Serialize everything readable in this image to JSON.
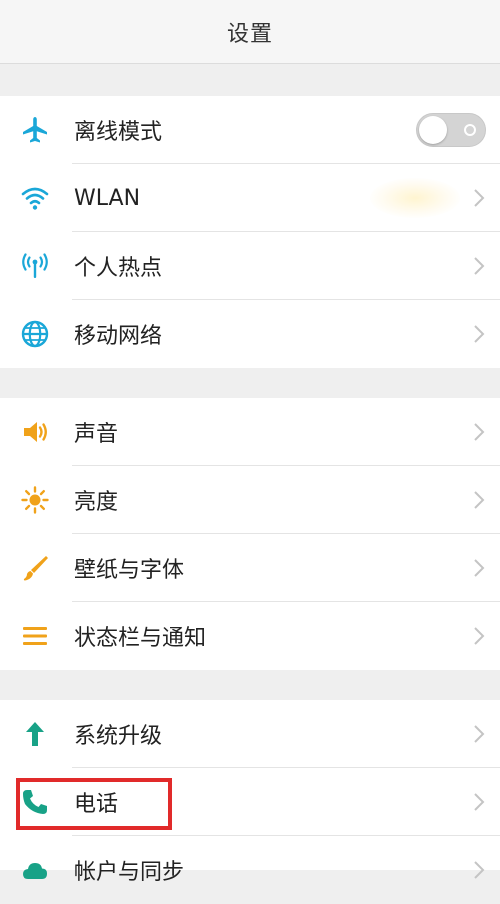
{
  "header": {
    "title": "设置"
  },
  "colors": {
    "accent": "#1aa7d8",
    "green": "#18a287",
    "orange": "#f0a21a",
    "highlight": "#e12a2a"
  },
  "groups": [
    {
      "items": [
        {
          "label": "离线模式",
          "icon": "airplane-icon",
          "control": "toggle",
          "toggle_on": false
        },
        {
          "label": "WLAN",
          "icon": "wifi-icon",
          "control": "chevron"
        },
        {
          "label": "个人热点",
          "icon": "hotspot-icon",
          "control": "chevron"
        },
        {
          "label": "移动网络",
          "icon": "globe-icon",
          "control": "chevron"
        }
      ]
    },
    {
      "items": [
        {
          "label": "声音",
          "icon": "speaker-icon",
          "control": "chevron"
        },
        {
          "label": "亮度",
          "icon": "sun-icon",
          "control": "chevron"
        },
        {
          "label": "壁纸与字体",
          "icon": "brush-icon",
          "control": "chevron"
        },
        {
          "label": "状态栏与通知",
          "icon": "list-icon",
          "control": "chevron"
        }
      ]
    },
    {
      "items": [
        {
          "label": "系统升级",
          "icon": "arrow-up-icon",
          "control": "chevron"
        },
        {
          "label": "电话",
          "icon": "phone-icon",
          "control": "chevron",
          "highlighted": true
        },
        {
          "label": "帐户与同步",
          "icon": "cloud-icon",
          "control": "chevron"
        }
      ]
    }
  ]
}
